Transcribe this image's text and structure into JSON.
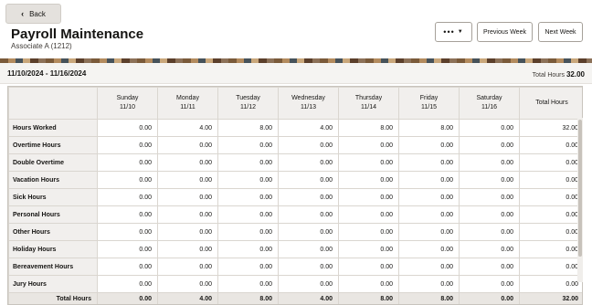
{
  "header": {
    "back_label": "Back",
    "title": "Payroll Maintenance",
    "subtitle": "Associate A (1212)",
    "more_label": "•••",
    "prev_label": "Previous Week",
    "next_label": "Next Week"
  },
  "summary": {
    "range": "11/10/2024 - 11/16/2024",
    "total_hours_label": "Total Hours",
    "total_hours_value": "32.00"
  },
  "grid": {
    "columns": [
      {
        "day": "Sunday",
        "date": "11/10"
      },
      {
        "day": "Monday",
        "date": "11/11"
      },
      {
        "day": "Tuesday",
        "date": "11/12"
      },
      {
        "day": "Wednesday",
        "date": "11/13"
      },
      {
        "day": "Thursday",
        "date": "11/14"
      },
      {
        "day": "Friday",
        "date": "11/15"
      },
      {
        "day": "Saturday",
        "date": "11/16"
      }
    ],
    "total_col_label": "Total Hours",
    "rows": [
      {
        "label": "Hours Worked",
        "values": [
          "0.00",
          "4.00",
          "8.00",
          "4.00",
          "8.00",
          "8.00",
          "0.00"
        ],
        "total": "32.00"
      },
      {
        "label": "Overtime Hours",
        "values": [
          "0.00",
          "0.00",
          "0.00",
          "0.00",
          "0.00",
          "0.00",
          "0.00"
        ],
        "total": "0.00"
      },
      {
        "label": "Double Overtime",
        "values": [
          "0.00",
          "0.00",
          "0.00",
          "0.00",
          "0.00",
          "0.00",
          "0.00"
        ],
        "total": "0.00"
      },
      {
        "label": "Vacation Hours",
        "values": [
          "0.00",
          "0.00",
          "0.00",
          "0.00",
          "0.00",
          "0.00",
          "0.00"
        ],
        "total": "0.00"
      },
      {
        "label": "Sick Hours",
        "values": [
          "0.00",
          "0.00",
          "0.00",
          "0.00",
          "0.00",
          "0.00",
          "0.00"
        ],
        "total": "0.00"
      },
      {
        "label": "Personal Hours",
        "values": [
          "0.00",
          "0.00",
          "0.00",
          "0.00",
          "0.00",
          "0.00",
          "0.00"
        ],
        "total": "0.00"
      },
      {
        "label": "Other Hours",
        "values": [
          "0.00",
          "0.00",
          "0.00",
          "0.00",
          "0.00",
          "0.00",
          "0.00"
        ],
        "total": "0.00"
      },
      {
        "label": "Holiday Hours",
        "values": [
          "0.00",
          "0.00",
          "0.00",
          "0.00",
          "0.00",
          "0.00",
          "0.00"
        ],
        "total": "0.00"
      },
      {
        "label": "Bereavement Hours",
        "values": [
          "0.00",
          "0.00",
          "0.00",
          "0.00",
          "0.00",
          "0.00",
          "0.00"
        ],
        "total": "0.00"
      },
      {
        "label": "Jury Hours",
        "values": [
          "0.00",
          "0.00",
          "0.00",
          "0.00",
          "0.00",
          "0.00",
          "0.00"
        ],
        "total": "0.00"
      }
    ],
    "footer": {
      "label": "Total Hours",
      "values": [
        "0.00",
        "4.00",
        "8.00",
        "4.00",
        "8.00",
        "8.00",
        "0.00"
      ],
      "total": "32.00"
    }
  },
  "icons": {
    "back": "chevron-left-icon",
    "more": "caret-down-icon"
  }
}
